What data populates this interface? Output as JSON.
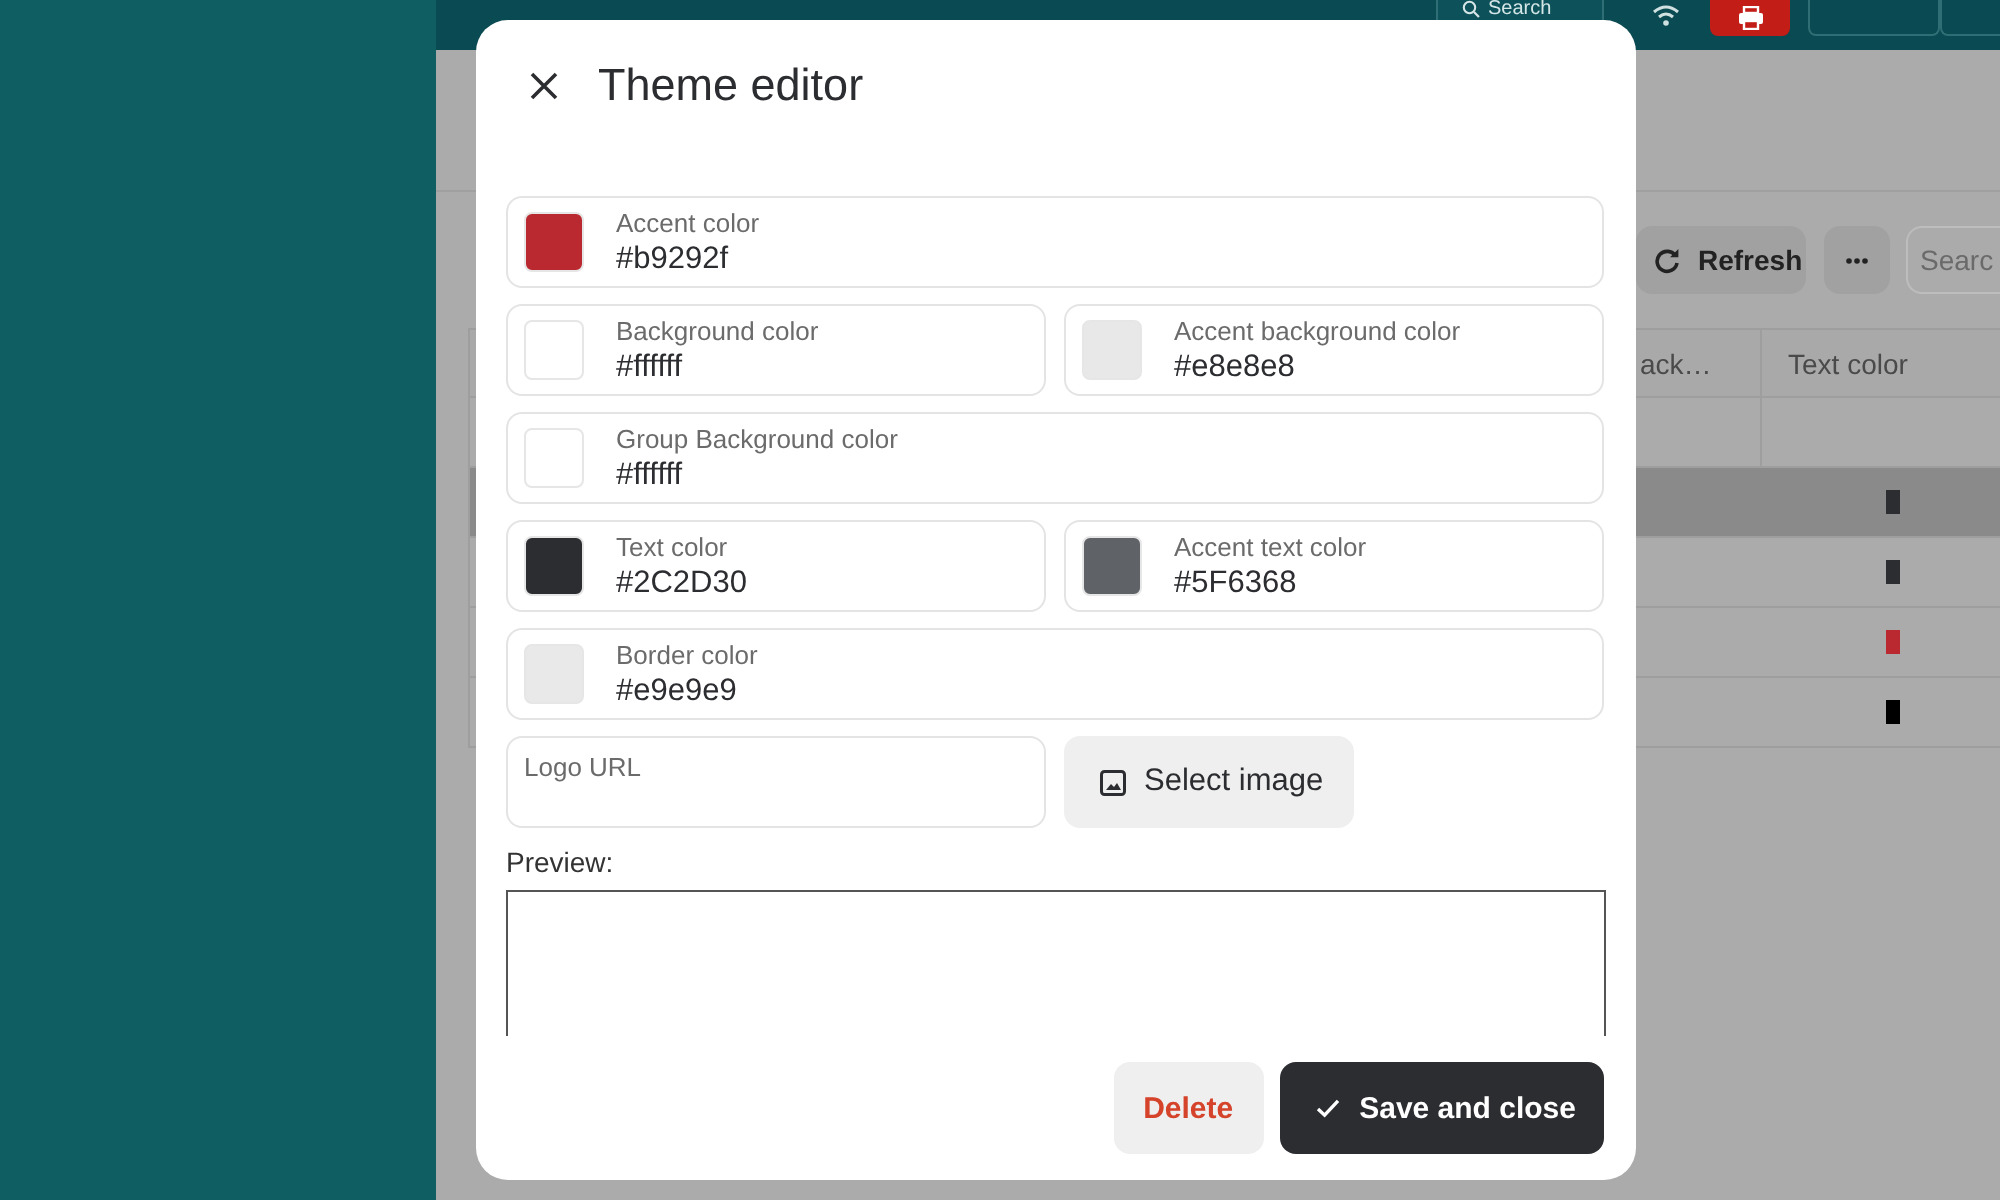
{
  "top_bar": {
    "search_button": "Search"
  },
  "toolbar": {
    "refresh_button": "Refresh",
    "search": {
      "placeholder": "Searc"
    }
  },
  "table": {
    "columns": [
      "ack…",
      "Text color"
    ],
    "rows": [
      {
        "selected": true,
        "color": "#2c2d30"
      },
      {
        "selected": false,
        "color": "#2c2d30"
      },
      {
        "selected": false,
        "color": "#b9292f"
      },
      {
        "selected": false,
        "color": "#000000"
      }
    ]
  },
  "dialog": {
    "title": "Theme editor",
    "field_rows": [
      [
        {
          "label": "Accent color",
          "value": "#b9292f",
          "color": "#b9292f"
        }
      ],
      [
        {
          "label": "Background color",
          "value": "#ffffff",
          "color": "#ffffff"
        },
        {
          "label": "Accent background color",
          "value": "#e8e8e8",
          "color": "#e8e8e8"
        }
      ],
      [
        {
          "label": "Group Background color",
          "value": "#ffffff",
          "color": "#ffffff"
        }
      ],
      [
        {
          "label": "Text color",
          "value": "#2C2D30",
          "color": "#2c2d30"
        },
        {
          "label": "Accent text color",
          "value": "#5F6368",
          "color": "#5f6368"
        }
      ],
      [
        {
          "label": "Border color",
          "value": "#e9e9e9",
          "color": "#e9e9e9"
        }
      ]
    ],
    "logo_field": {
      "label": "Logo URL"
    },
    "select_image_button": "Select image",
    "preview": {
      "label": "Preview:"
    },
    "buttons": [
      {
        "label": "Delete",
        "kind": "danger"
      },
      {
        "label": "Save and close",
        "kind": "primary"
      }
    ]
  }
}
